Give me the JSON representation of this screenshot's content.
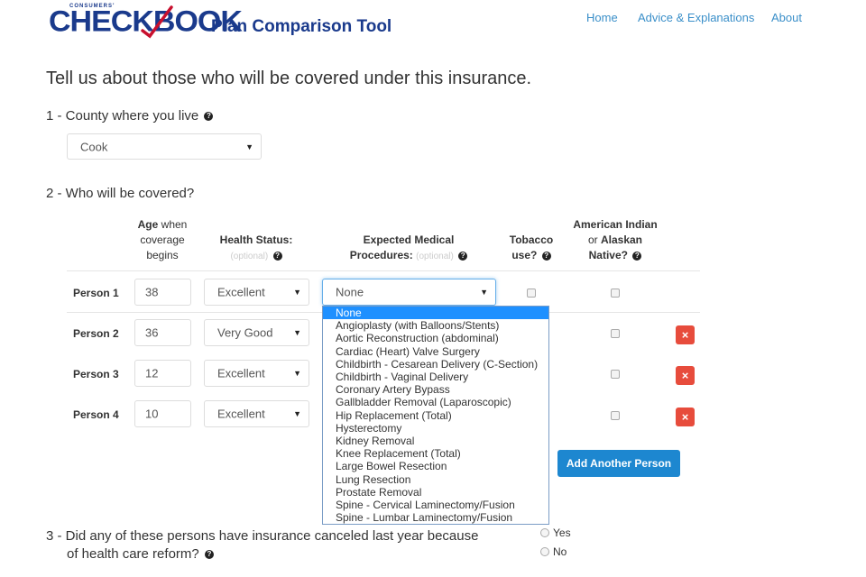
{
  "header": {
    "logo_small": "CONSUMERS'",
    "logo_main": "CHECKBOOK",
    "logo_title": "Plan Comparison Tool",
    "nav": [
      "Home",
      "Advice & Explanations",
      "About"
    ]
  },
  "main_heading": "Tell us about those who will be covered under this insurance.",
  "q1": {
    "label": "1 - County where you live",
    "county_value": "Cook"
  },
  "q2": {
    "label": "2 - Who will be covered?",
    "headers": {
      "age_bold": "Age",
      "age_rest1": "when",
      "age_rest2": "coverage",
      "age_rest3": "begins",
      "health": "Health Status:",
      "health_opt": "(optional)",
      "proc1": "Expected Medical",
      "proc2": "Procedures:",
      "proc_opt": "(optional)",
      "tobacco1": "Tobacco",
      "tobacco2": "use?",
      "ai1": "American Indian",
      "ai2": "or",
      "ai3": "Alaskan",
      "ai4": "Native?"
    },
    "persons": [
      {
        "label": "Person 1",
        "age": "38",
        "health": "Excellent",
        "procedure": "None"
      },
      {
        "label": "Person 2",
        "age": "36",
        "health": "Very Good"
      },
      {
        "label": "Person 3",
        "age": "12",
        "health": "Excellent"
      },
      {
        "label": "Person 4",
        "age": "10",
        "health": "Excellent"
      }
    ],
    "delete_label": "×",
    "add_button": "Add Another Person",
    "procedure_options": [
      "None",
      "Angioplasty (with Balloons/Stents)",
      "Aortic Reconstruction (abdominal)",
      "Cardiac (Heart) Valve Surgery",
      "Childbirth - Cesarean Delivery (C-Section)",
      "Childbirth - Vaginal Delivery",
      "Coronary Artery Bypass",
      "Gallbladder Removal (Laparoscopic)",
      "Hip Replacement (Total)",
      "Hysterectomy",
      "Kidney Removal",
      "Knee Replacement (Total)",
      "Large Bowel Resection",
      "Lung Resection",
      "Prostate Removal",
      "Spine - Cervical Laminectomy/Fusion",
      "Spine - Lumbar Laminectomy/Fusion"
    ]
  },
  "q3": {
    "line1": "3 - Did any of these persons have insurance canceled last year because",
    "line2": "of health care reform?",
    "yes": "Yes",
    "no": "No"
  },
  "colors": {
    "brand": "#1a3a8c",
    "accent": "#c8102e",
    "link": "#3a8fc9",
    "primary_button": "#1d87d0",
    "danger": "#e74c3c",
    "selected": "#1e90ff"
  },
  "icons": {
    "help": "question-circle-icon",
    "caret": "caret-down-icon",
    "delete": "close-icon"
  }
}
